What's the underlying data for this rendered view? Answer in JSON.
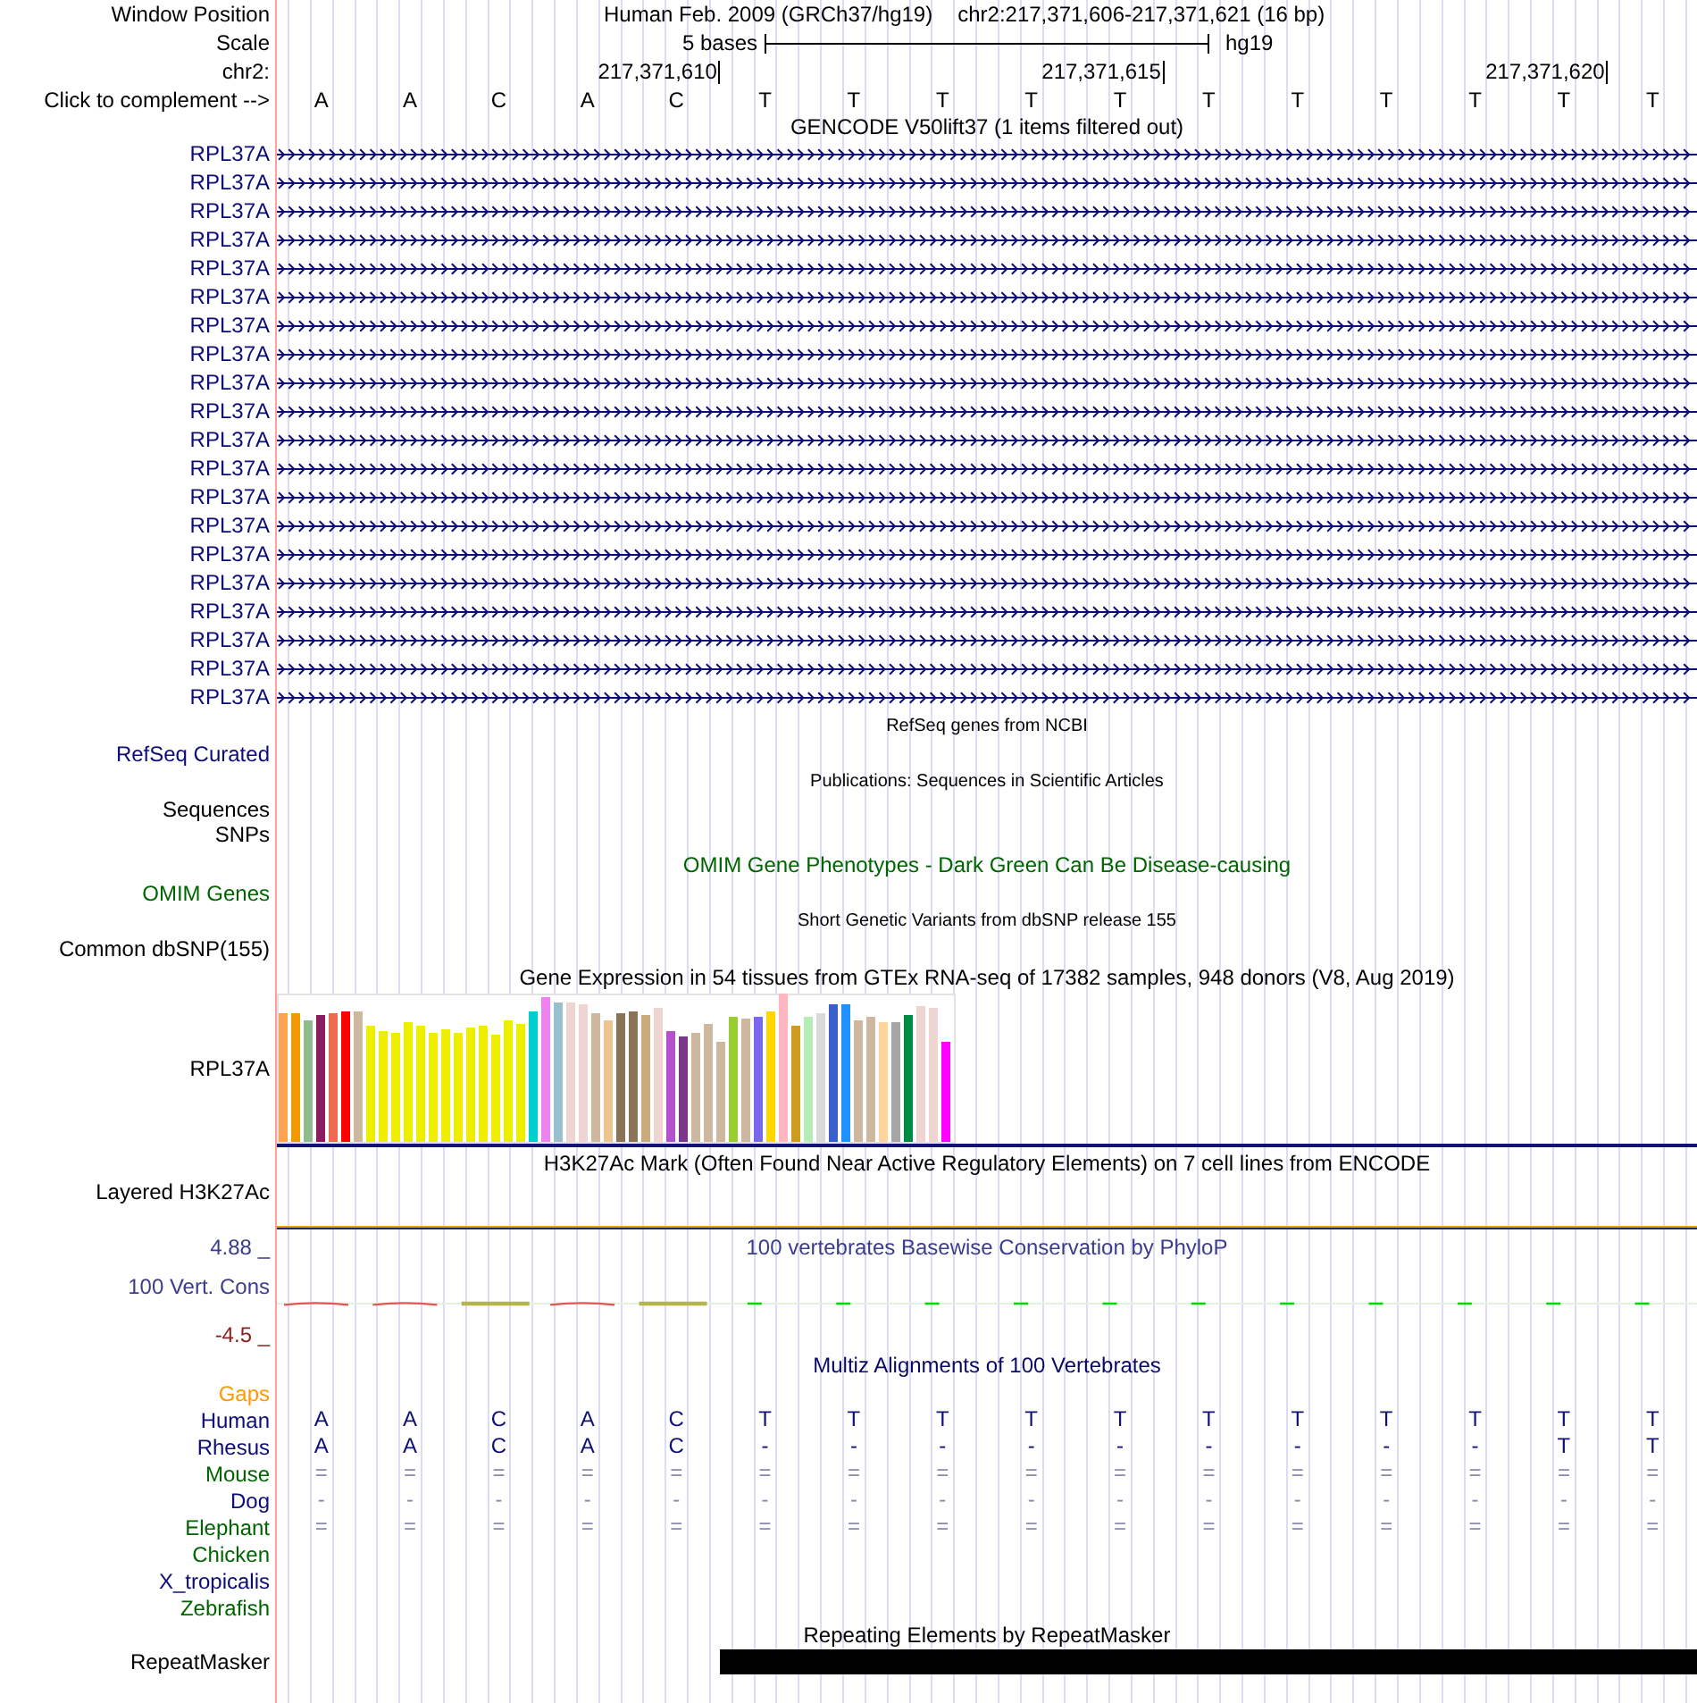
{
  "header": {
    "label": "Window Position",
    "assembly": "Human Feb. 2009 (GRCh37/hg19)",
    "position": "chr2:217,371,606-217,371,621 (16 bp)"
  },
  "scale": {
    "label": "Scale",
    "span": "5 bases",
    "assembly": "hg19"
  },
  "ruler": {
    "label": "chr2:",
    "ticks": [
      "217,371,610",
      "217,371,615",
      "217,371,620"
    ]
  },
  "sequence": {
    "label": "Click to complement -->",
    "bases": [
      "A",
      "A",
      "C",
      "A",
      "C",
      "T",
      "T",
      "T",
      "T",
      "T",
      "T",
      "T",
      "T",
      "T",
      "T",
      "T"
    ]
  },
  "tracks": [
    {
      "kind": "genes",
      "title": {
        "text": "GENCODE V50lift37 (1 items filtered out)",
        "color": "#000000"
      },
      "labels": [
        {
          "text": "RPL37A",
          "color": "#0c0c78"
        },
        {
          "text": "RPL37A",
          "color": "#0c0c78"
        },
        {
          "text": "RPL37A",
          "color": "#0c0c78"
        },
        {
          "text": "RPL37A",
          "color": "#0c0c78"
        },
        {
          "text": "RPL37A",
          "color": "#0c0c78"
        },
        {
          "text": "RPL37A",
          "color": "#0c0c78"
        },
        {
          "text": "RPL37A",
          "color": "#0c0c78"
        },
        {
          "text": "RPL37A",
          "color": "#0c0c78"
        },
        {
          "text": "RPL37A",
          "color": "#0c0c78"
        },
        {
          "text": "RPL37A",
          "color": "#0c0c78"
        },
        {
          "text": "RPL37A",
          "color": "#0c0c78"
        },
        {
          "text": "RPL37A",
          "color": "#0c0c78"
        },
        {
          "text": "RPL37A",
          "color": "#0c0c78"
        },
        {
          "text": "RPL37A",
          "color": "#0c0c78"
        },
        {
          "text": "RPL37A",
          "color": "#0c0c78"
        },
        {
          "text": "RPL37A",
          "color": "#0c0c78"
        },
        {
          "text": "RPL37A",
          "color": "#0c0c78"
        },
        {
          "text": "RPL37A",
          "color": "#0c0c78"
        },
        {
          "text": "RPL37A",
          "color": "#0c0c78"
        },
        {
          "text": "RPL37A",
          "color": "#0c0c78"
        }
      ]
    },
    {
      "kind": "empty_compact",
      "title": {
        "text": "RefSeq genes from NCBI",
        "color": "#000000"
      },
      "labels": [
        {
          "text": "RefSeq Curated",
          "color": "#0c0c78"
        }
      ]
    },
    {
      "kind": "empty_compact",
      "title": {
        "text": "Publications: Sequences in Scientific Articles",
        "color": "#000000"
      },
      "labels": [
        {
          "text": "Sequences",
          "color": "#000000"
        },
        {
          "text": "SNPs",
          "color": "#000000"
        }
      ]
    },
    {
      "kind": "empty",
      "title": {
        "text": "OMIM Gene Phenotypes - Dark Green Can Be Disease-causing",
        "color": "#006400"
      },
      "labels": [
        {
          "text": "OMIM Genes",
          "color": "#006400"
        }
      ]
    },
    {
      "kind": "empty_compact",
      "title": {
        "text": "Short Genetic Variants from dbSNP release 155",
        "color": "#000000"
      },
      "labels": [
        {
          "text": "Common dbSNP(155)",
          "color": "#000000"
        }
      ]
    },
    {
      "kind": "expression",
      "title": {
        "text": "Gene Expression in 54 tissues from GTEx RNA-seq of 17382 samples, 948 donors (V8, Aug 2019)",
        "color": "#000000"
      },
      "labels": [
        {
          "text": "RPL37A",
          "color": "#000000"
        }
      ],
      "bars": [
        {
          "color": "#ffa54f"
        },
        {
          "color": "#ee9a00"
        },
        {
          "color": "#8fbc8f"
        },
        {
          "color": "#8b1c62"
        },
        {
          "color": "#ee6a50"
        },
        {
          "color": "#ff0000"
        },
        {
          "color": "#cdb79e"
        },
        {
          "color": "#eeee00"
        },
        {
          "color": "#eeee00"
        },
        {
          "color": "#eeee00"
        },
        {
          "color": "#eeee00"
        },
        {
          "color": "#eeee00"
        },
        {
          "color": "#eeee00"
        },
        {
          "color": "#eeee00"
        },
        {
          "color": "#eeee00"
        },
        {
          "color": "#eeee00"
        },
        {
          "color": "#eeee00"
        },
        {
          "color": "#eeee00"
        },
        {
          "color": "#eeee00"
        },
        {
          "color": "#eeee00"
        },
        {
          "color": "#00cdcd"
        },
        {
          "color": "#ee82ee"
        },
        {
          "color": "#9ac0cd"
        },
        {
          "color": "#eed5d2"
        },
        {
          "color": "#eed5d2"
        },
        {
          "color": "#cdb79e"
        },
        {
          "color": "#eec591"
        },
        {
          "color": "#8b7355"
        },
        {
          "color": "#8b7355"
        },
        {
          "color": "#cdaa7d"
        },
        {
          "color": "#eed5d2"
        },
        {
          "color": "#b452cd"
        },
        {
          "color": "#7a378b"
        },
        {
          "color": "#cdb79e"
        },
        {
          "color": "#cdb79e"
        },
        {
          "color": "#cdb79e"
        },
        {
          "color": "#9acd32"
        },
        {
          "color": "#cdb79e"
        },
        {
          "color": "#7a67ee"
        },
        {
          "color": "#ffd700"
        },
        {
          "color": "#ffb6c1"
        },
        {
          "color": "#cd9b1d"
        },
        {
          "color": "#b4eeb4"
        },
        {
          "color": "#d9d9d9"
        },
        {
          "color": "#3a5fcd"
        },
        {
          "color": "#1e90ff"
        },
        {
          "color": "#cdb79e"
        },
        {
          "color": "#cdb79e"
        },
        {
          "color": "#ffd39b"
        },
        {
          "color": "#a6a6a6"
        },
        {
          "color": "#008b45"
        },
        {
          "color": "#eed5d2"
        },
        {
          "color": "#eed5d2"
        },
        {
          "color": "#ff00ff"
        }
      ]
    },
    {
      "kind": "signal",
      "title": {
        "text": "H3K27Ac Mark (Often Found Near Active Regulatory Elements) on 7 cell lines from ENCODE",
        "color": "#000000"
      },
      "labels": [
        {
          "text": "Layered H3K27Ac",
          "color": "#000000"
        }
      ]
    },
    {
      "kind": "wiggle",
      "title": {
        "text": "100 vertebrates Basewise Conservation by PhyloP",
        "color": "#3c3c8c"
      },
      "labels": [
        {
          "text": "100 Vert. Cons",
          "color": "#3c3c8c"
        }
      ],
      "scale_labels": [
        {
          "text": "4.88 _",
          "color": "#3c3c8c"
        },
        {
          "text": "-4.5 _",
          "color": "#8c1e1e"
        }
      ]
    },
    {
      "kind": "alignment",
      "title": {
        "text": "Multiz Alignments of 100 Vertebrates",
        "color": "#0a0a64"
      },
      "rows": [
        {
          "kind": "none",
          "label": "Gaps",
          "color": "#ff9900"
        },
        {
          "kind": "bases",
          "label": "Human",
          "color": "#0c0c78",
          "bases": [
            "A",
            "A",
            "C",
            "A",
            "C",
            "T",
            "T",
            "T",
            "T",
            "T",
            "T",
            "T",
            "T",
            "T",
            "T",
            "T"
          ]
        },
        {
          "kind": "bases",
          "label": "Rhesus",
          "color": "#0c0c78",
          "bases": [
            "A",
            "A",
            "C",
            "A",
            "C",
            "-",
            "-",
            "-",
            "-",
            "-",
            "-",
            "-",
            "-",
            "-",
            "T",
            "T"
          ]
        },
        {
          "kind": "symbols",
          "label": "Mouse",
          "color": "#006400",
          "bases": [
            "=",
            "=",
            "=",
            "=",
            "=",
            "=",
            "=",
            "=",
            "=",
            "=",
            "=",
            "=",
            "=",
            "=",
            "=",
            "="
          ]
        },
        {
          "kind": "symbols",
          "label": "Dog",
          "color": "#0c0c78",
          "bases": [
            "-",
            "-",
            "-",
            "-",
            "-",
            "-",
            "-",
            "-",
            "-",
            "-",
            "-",
            "-",
            "-",
            "-",
            "-",
            "-"
          ]
        },
        {
          "kind": "symbols",
          "label": "Elephant",
          "color": "#006400",
          "bases": [
            "=",
            "=",
            "=",
            "=",
            "=",
            "=",
            "=",
            "=",
            "=",
            "=",
            "=",
            "=",
            "=",
            "=",
            "=",
            "="
          ]
        },
        {
          "kind": "none",
          "label": "Chicken",
          "color": "#006400"
        },
        {
          "kind": "none",
          "label": "X_tropicalis",
          "color": "#0c0c78"
        },
        {
          "kind": "none",
          "label": "Zebrafish",
          "color": "#006400"
        }
      ]
    },
    {
      "kind": "repeats",
      "title": {
        "text": "Repeating Elements by RepeatMasker",
        "color": "#000000"
      },
      "labels": [
        {
          "text": "RepeatMasker",
          "color": "#000000"
        }
      ]
    }
  ]
}
